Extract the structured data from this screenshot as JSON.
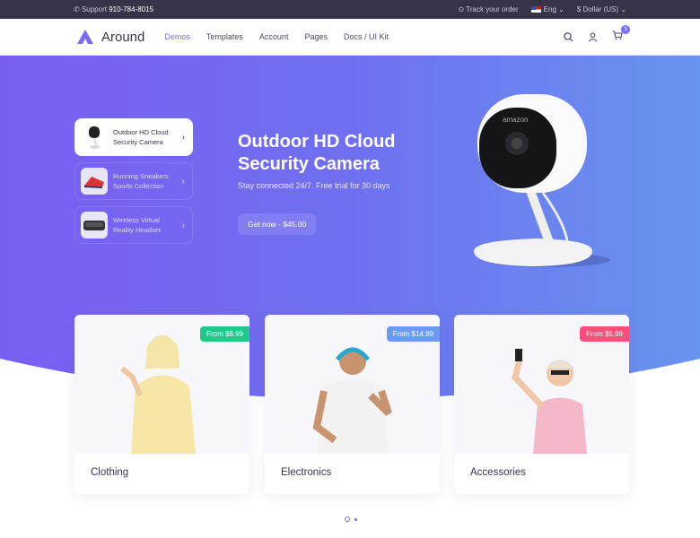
{
  "topbar": {
    "support_label": "Support",
    "phone": "910-784-8015",
    "track": "Track your order",
    "lang": "Eng",
    "currency": "$ Dollar (US)"
  },
  "nav": {
    "brand": "Around",
    "items": [
      "Demos",
      "Templates",
      "Account",
      "Pages",
      "Docs / UI Kit"
    ],
    "cart_count": "3"
  },
  "hero": {
    "tabs": [
      {
        "line1": "Outdoor HD Cloud",
        "line2": "Security Camera"
      },
      {
        "line1": "Running Sneakers",
        "line2": "Sports Collection"
      },
      {
        "line1": "Wireless Virtual",
        "line2": "Reality Headset"
      }
    ],
    "title_line1": "Outdoor HD Cloud",
    "title_line2": "Security Camera",
    "subtitle": "Stay connected 24/7. Free trial for 30 days",
    "cta": "Get now - $45.00",
    "camera_brand": "amazon"
  },
  "categories": [
    {
      "name": "Clothing",
      "price": "From $8.99",
      "color": "#1fc98a"
    },
    {
      "name": "Electronics",
      "price": "From $14.99",
      "color": "#6a9bf4"
    },
    {
      "name": "Accessories",
      "price": "From $5.99",
      "color": "#f74f78"
    }
  ],
  "colors": {
    "accent": "#766df4",
    "topbar": "#37344a"
  }
}
